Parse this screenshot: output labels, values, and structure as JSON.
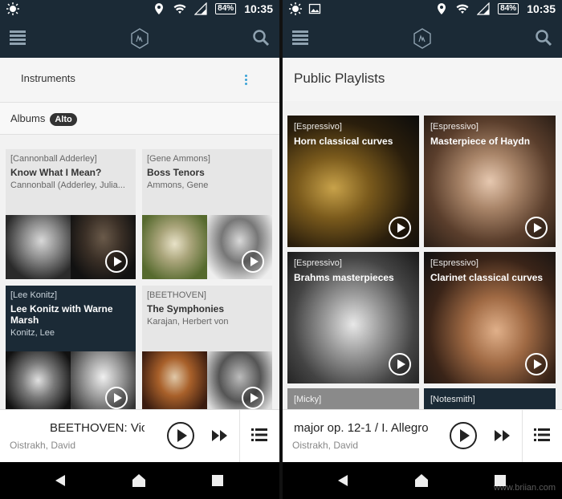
{
  "status": {
    "battery": "84%",
    "time": "10:35"
  },
  "icons": {
    "status_left": "brightness-icon",
    "status_image": "image-icon",
    "location": "location-icon",
    "wifi": "wifi-icon",
    "signal": "signal-icon",
    "menu": "list-menu-icon",
    "logo": "app-logo-icon",
    "search": "search-icon"
  },
  "left": {
    "instruments_label": "Instruments",
    "albums_label": "Albums",
    "albums_badge": "Alto",
    "albums": [
      {
        "tag": "[Cannonball Adderley]",
        "title": "Know What I Mean?",
        "artist": "Cannonball (Adderley, Julia..."
      },
      {
        "tag": "[Gene Ammons]",
        "title": "Boss Tenors",
        "artist": "Ammons, Gene"
      },
      {
        "tag": "[Lee Konitz]",
        "title": "Lee Konitz with Warne Marsh",
        "artist": "Konitz, Lee"
      },
      {
        "tag": "[BEETHOVEN]",
        "title": "The Symphonies",
        "artist": "Karajan, Herbert von"
      }
    ],
    "player": {
      "track": "BEETHOVEN: Violin",
      "artist": "Oistrakh, David"
    }
  },
  "right": {
    "section_title": "Public Playlists",
    "playlists": [
      {
        "tag": "[Espressivo]",
        "title": "Horn classical curves"
      },
      {
        "tag": "[Espressivo]",
        "title": "Masterpiece of Haydn"
      },
      {
        "tag": "[Espressivo]",
        "title": "Brahms masterpieces"
      },
      {
        "tag": "[Espressivo]",
        "title": "Clarinet classical curves"
      },
      {
        "tag": "[Micky]",
        "title": ""
      },
      {
        "tag": "[Notesmith]",
        "title": ""
      }
    ],
    "player": {
      "track": "major op. 12-1 / I. Allegro",
      "artist": "Oistrakh, David"
    }
  },
  "watermark": "www.briian.com",
  "colors": {
    "appbar": "#1b2a36",
    "accent": "#3ba2d6"
  }
}
